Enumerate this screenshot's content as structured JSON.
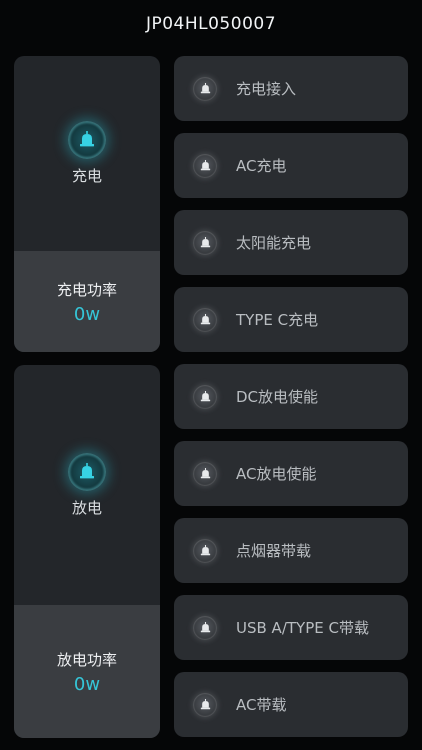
{
  "device_id": "JP04HL050007",
  "charge_panel": {
    "label": "充电",
    "power_label": "充电功率",
    "power_value": "0w",
    "icon": "bell-icon"
  },
  "discharge_panel": {
    "label": "放电",
    "power_label": "放电功率",
    "power_value": "0w",
    "icon": "bell-icon"
  },
  "items": [
    {
      "label": "充电接入",
      "icon": "bell-icon"
    },
    {
      "label": "AC充电",
      "icon": "bell-icon"
    },
    {
      "label": "太阳能充电",
      "icon": "bell-icon"
    },
    {
      "label": "TYPE C充电",
      "icon": "bell-icon"
    },
    {
      "label": "DC放电使能",
      "icon": "bell-icon"
    },
    {
      "label": "AC放电使能",
      "icon": "bell-icon"
    },
    {
      "label": "点烟器带载",
      "icon": "bell-icon"
    },
    {
      "label": "USB A/TYPE C带载",
      "icon": "bell-icon"
    },
    {
      "label": "AC带载",
      "icon": "bell-icon"
    }
  ],
  "colors": {
    "accent": "#35c6d8",
    "panel": "#23262a",
    "panel_bottom": "#3a3d41",
    "item": "#2a2d31"
  }
}
